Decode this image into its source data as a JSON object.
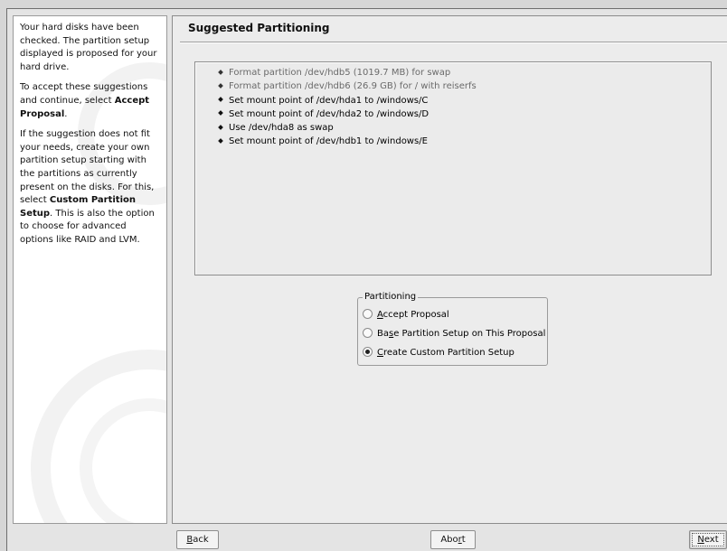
{
  "help": {
    "p1": "Your hard disks have been checked. The partition setup displayed is proposed for your hard drive.",
    "p2_pre": "To accept these suggestions and continue, select ",
    "p2_bold": "Accept Proposal",
    "p2_post": ".",
    "p3_pre": "If the suggestion does not fit your needs, create your own partition setup starting with the partitions as currently present on the disks. For this, select ",
    "p3_bold": "Custom Partition Setup",
    "p3_post": ". This is also the option to choose for advanced options like RAID and LVM."
  },
  "main": {
    "title": "Suggested Partitioning",
    "proposal": [
      {
        "text": "Format partition /dev/hdb5 (1019.7 MB) for swap",
        "muted": true
      },
      {
        "text": "Format partition /dev/hdb6 (26.9 GB) for / with reiserfs",
        "muted": true
      },
      {
        "text": "Set mount point of /dev/hda1 to /windows/C",
        "muted": false
      },
      {
        "text": "Set mount point of /dev/hda2 to /windows/D",
        "muted": false
      },
      {
        "text": "Use /dev/hda8 as swap",
        "muted": false
      },
      {
        "text": "Set mount point of /dev/hdb1 to /windows/E",
        "muted": false
      }
    ]
  },
  "partitioning": {
    "legend": "Partitioning",
    "options": [
      {
        "pre": "",
        "mnemonic": "A",
        "post": "ccept Proposal",
        "selected": false
      },
      {
        "pre": "Ba",
        "mnemonic": "s",
        "post": "e Partition Setup on This Proposal",
        "selected": false
      },
      {
        "pre": "",
        "mnemonic": "C",
        "post": "reate Custom Partition Setup",
        "selected": true
      }
    ]
  },
  "buttons": {
    "back": {
      "pre": "",
      "mnemonic": "B",
      "post": "ack"
    },
    "abort": {
      "pre": "Abo",
      "mnemonic": "r",
      "post": "t"
    },
    "next": {
      "pre": "",
      "mnemonic": "N",
      "post": "ext"
    }
  }
}
